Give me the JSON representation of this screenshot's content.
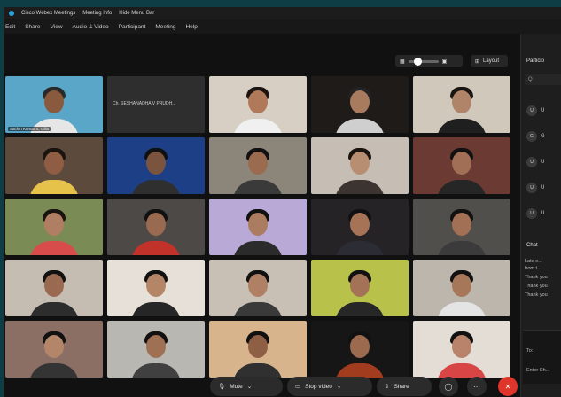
{
  "titlebar": {
    "items": [
      "Cisco Webex Meetings",
      "Meeting Info",
      "Hide Menu Bar"
    ]
  },
  "menubar": {
    "items": [
      "Edit",
      "Share",
      "View",
      "Audio & Video",
      "Participant",
      "Meeting",
      "Help"
    ]
  },
  "toolbar": {
    "layout_label": "Layout"
  },
  "tiles": [
    {
      "name": "Sachin Kumar S. Gilla",
      "bg": "#5aa6c8",
      "skin": "#8a5a3e",
      "shirt": "#e6e6e6",
      "hair": "#2a2a2a"
    },
    {
      "name": "",
      "label": "Ch. SESHANADHA V PRUDH...",
      "bg": "#2e2e2e",
      "empty": true
    },
    {
      "name": "",
      "bg": "#d7cfc4",
      "skin": "#b07a5a",
      "shirt": "#f0f0f0",
      "hair": "#1c1410"
    },
    {
      "name": "",
      "bg": "#1f1b18",
      "skin": "#a87a5e",
      "shirt": "#cfcfcf",
      "hair": "#222"
    },
    {
      "name": "",
      "bg": "#cfc8bb",
      "skin": "#b08468",
      "shirt": "#1f1f1f",
      "hair": "#1a1410"
    },
    {
      "name": "",
      "bg": "#5c4a3c",
      "skin": "#8e5d44",
      "shirt": "#e7c24b",
      "hair": "#1a1410"
    },
    {
      "name": "",
      "bg": "#1d3f86",
      "skin": "#7b5440",
      "shirt": "#2f2f2f",
      "hair": "#111"
    },
    {
      "name": "",
      "bg": "#8c8579",
      "skin": "#9a6b4f",
      "shirt": "#3a3a3a",
      "hair": "#111"
    },
    {
      "name": "",
      "bg": "#c6beb5",
      "skin": "#b88e73",
      "shirt": "#3c3431",
      "hair": "#1a1410"
    },
    {
      "name": "",
      "bg": "#6a3a33",
      "skin": "#a06f55",
      "shirt": "#262626",
      "hair": "#111"
    },
    {
      "name": "",
      "bg": "#7a8b55",
      "skin": "#b07e63",
      "shirt": "#d94c4c",
      "hair": "#1a1410"
    },
    {
      "name": "",
      "bg": "#4d4946",
      "skin": "#9a6a50",
      "shirt": "#c0322a",
      "hair": "#111"
    },
    {
      "name": "",
      "bg": "#b9a9d6",
      "skin": "#ac7c60",
      "shirt": "#2b2b2b",
      "hair": "#111"
    },
    {
      "name": "",
      "bg": "#262326",
      "skin": "#a77357",
      "shirt": "#2c2c34",
      "hair": "#111"
    },
    {
      "name": "",
      "bg": "#514f4c",
      "skin": "#a27054",
      "shirt": "#3b3b3b",
      "hair": "#111"
    },
    {
      "name": "",
      "bg": "#c6bdb2",
      "skin": "#9a6a50",
      "shirt": "#2d2d2d",
      "hair": "#111"
    },
    {
      "name": "",
      "bg": "#e6e0d8",
      "skin": "#b58568",
      "shirt": "#262626",
      "hair": "#111"
    },
    {
      "name": "",
      "bg": "#c8bfb5",
      "skin": "#b08064",
      "shirt": "#3a3a3a",
      "hair": "#111"
    },
    {
      "name": "",
      "bg": "#b8c14a",
      "skin": "#a47256",
      "shirt": "#272727",
      "hair": "#111"
    },
    {
      "name": "",
      "bg": "#bdb6ad",
      "skin": "#a7775a",
      "shirt": "#e4e4e4",
      "hair": "#111"
    },
    {
      "name": "",
      "bg": "#8b6f65",
      "skin": "#b3866a",
      "shirt": "#343434",
      "hair": "#111"
    },
    {
      "name": "",
      "bg": "#b9b7b1",
      "skin": "#9f7054",
      "shirt": "#404040",
      "hair": "#111"
    },
    {
      "name": "",
      "bg": "#d8b48c",
      "skin": "#8f5f45",
      "shirt": "#303030",
      "hair": "#111"
    },
    {
      "name": "",
      "bg": "#161616",
      "skin": "#9c6a4f",
      "shirt": "#a23c1f",
      "hair": "#111"
    },
    {
      "name": "",
      "bg": "#e3ddd6",
      "skin": "#b8836a",
      "shirt": "#d84545",
      "hair": "#111"
    }
  ],
  "participants_panel": {
    "title": "Particip",
    "search_placeholder": "Q",
    "rows": [
      "U",
      "G",
      "U",
      "U",
      "U"
    ]
  },
  "chat_panel": {
    "title": "Chat",
    "lines": [
      "Late e...",
      "from t...",
      "Thank you",
      "Thank you",
      "Thank you"
    ],
    "to_label": "To:",
    "input_placeholder": "Enter Ch..."
  },
  "controls": {
    "mute": "Mute",
    "stop_video": "Stop video",
    "share": "Share"
  },
  "colors": {
    "end_meeting": "#e0352b",
    "background": "#141414"
  }
}
